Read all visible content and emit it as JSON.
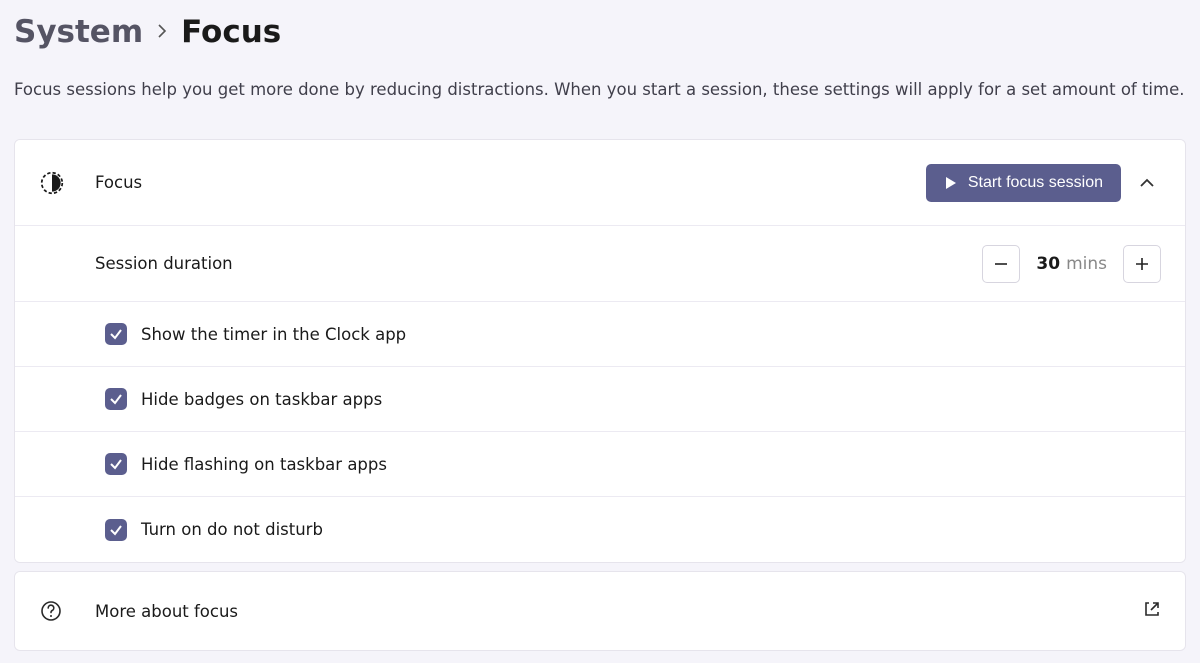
{
  "breadcrumb": {
    "parent": "System",
    "current": "Focus"
  },
  "description": "Focus sessions help you get more done by reducing distractions. When you start a session, these settings will apply for a set amount of time.",
  "focus": {
    "header_label": "Focus",
    "start_button": "Start focus session",
    "duration": {
      "label": "Session duration",
      "value": "30",
      "unit": "mins"
    },
    "options": [
      {
        "label": "Show the timer in the Clock app",
        "checked": true
      },
      {
        "label": "Hide badges on taskbar apps",
        "checked": true
      },
      {
        "label": "Hide flashing on taskbar apps",
        "checked": true
      },
      {
        "label": "Turn on do not disturb",
        "checked": true
      }
    ]
  },
  "more": {
    "label": "More about focus"
  }
}
